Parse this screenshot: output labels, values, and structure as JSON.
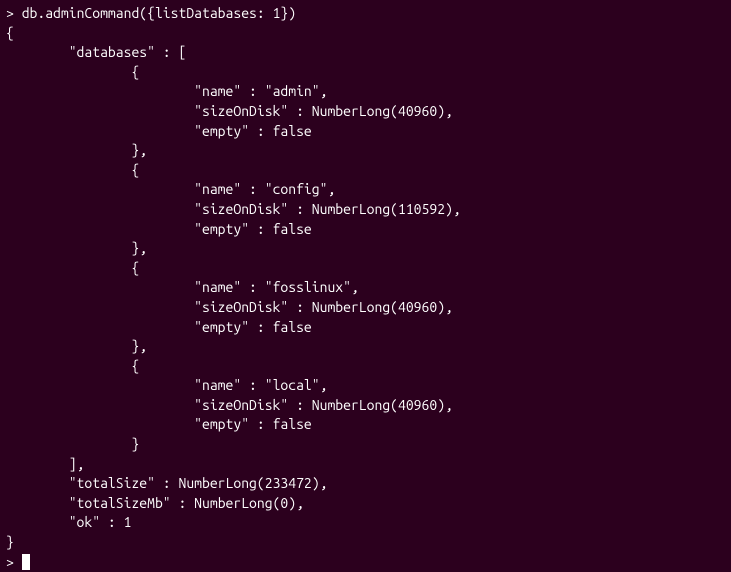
{
  "command": "db.adminCommand({listDatabases: 1})",
  "output": {
    "databases": [
      {
        "name": "admin",
        "sizeOnDisk": "NumberLong(40960)",
        "empty": "false"
      },
      {
        "name": "config",
        "sizeOnDisk": "NumberLong(110592)",
        "empty": "false"
      },
      {
        "name": "fosslinux",
        "sizeOnDisk": "NumberLong(40960)",
        "empty": "false"
      },
      {
        "name": "local",
        "sizeOnDisk": "NumberLong(40960)",
        "empty": "false"
      }
    ],
    "totalSize": "NumberLong(233472)",
    "totalSizeMb": "NumberLong(0)",
    "ok": "1"
  },
  "prompt_char": "> "
}
